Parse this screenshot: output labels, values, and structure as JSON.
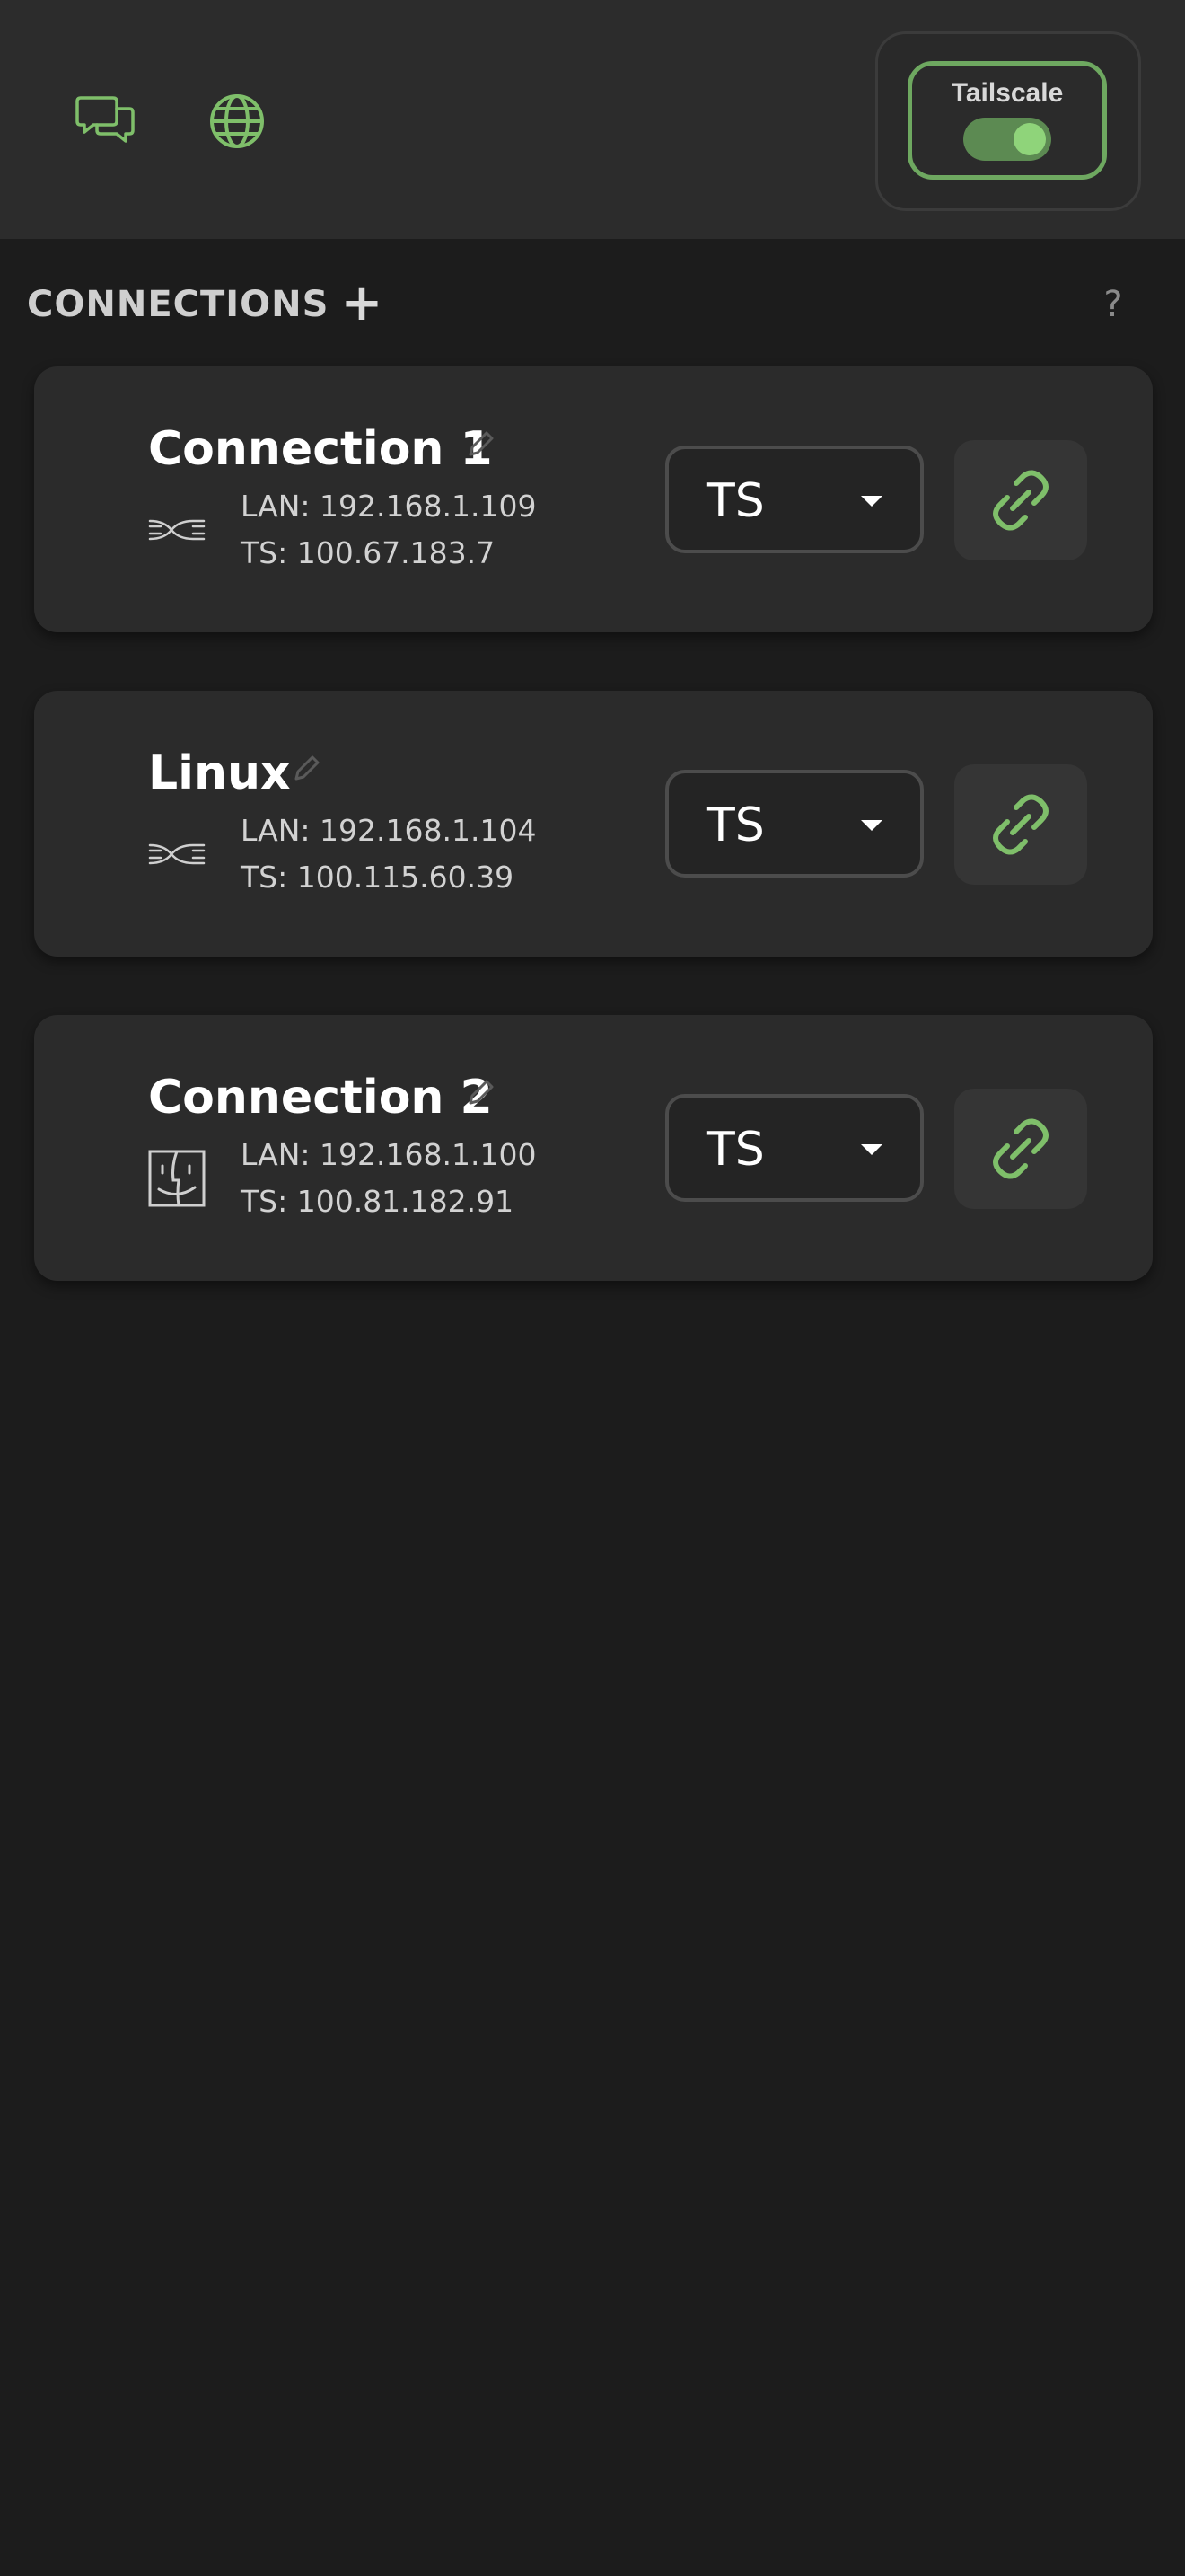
{
  "colors": {
    "accent": "#7fbf6a",
    "background": "#1c1c1c",
    "topbar": "#2c2c2c",
    "card": "#2b2b2b"
  },
  "topbar": {
    "icons": [
      "chat-icon",
      "globe-icon"
    ],
    "tailscale_label": "Tailscale",
    "tailscale_enabled": true
  },
  "section": {
    "title": "CONNECTIONS",
    "add_label": "+",
    "help_label": "?"
  },
  "connections": [
    {
      "name": "Connection 1",
      "os_icon": "network-icon",
      "lan": "LAN: 192.168.1.109",
      "ts": "TS: 100.67.183.7",
      "mode": "TS"
    },
    {
      "name": "Linux",
      "os_icon": "network-icon",
      "lan": "LAN: 192.168.1.104",
      "ts": "TS: 100.115.60.39",
      "mode": "TS"
    },
    {
      "name": "Connection 2",
      "os_icon": "finder-icon",
      "lan": "LAN: 192.168.1.100",
      "ts": "TS: 100.81.182.91",
      "mode": "TS"
    }
  ]
}
